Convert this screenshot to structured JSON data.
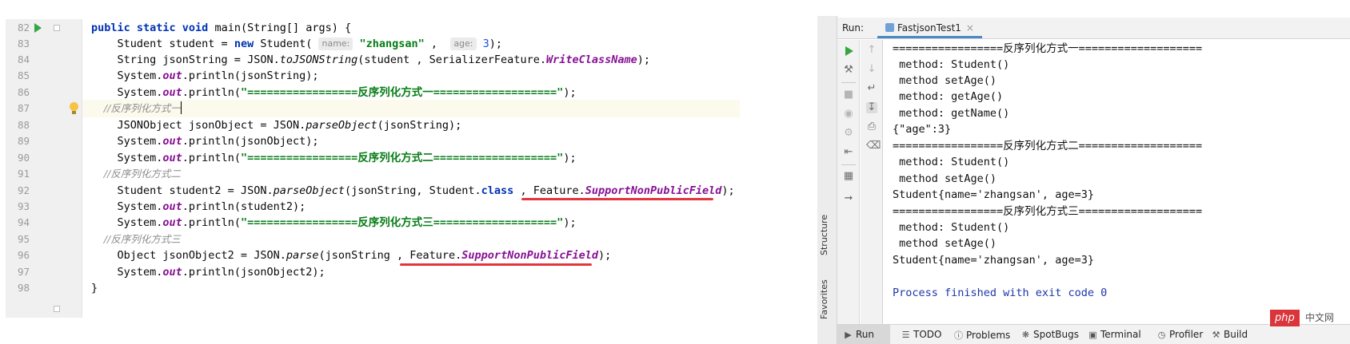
{
  "editor": {
    "line_numbers": [
      "82",
      "83",
      "84",
      "85",
      "86",
      "87",
      "88",
      "89",
      "90",
      "91",
      "92",
      "93",
      "94",
      "95",
      "96",
      "97",
      "98"
    ],
    "code": {
      "l82_a": "public static void ",
      "l82_b": "main(String[] args) {",
      "l83_a": "    Student student = ",
      "l83_new": "new ",
      "l83_b": "Student( ",
      "l83_hint1": "name:",
      "l83_str": " \"zhangsan\"",
      "l83_c": " ,  ",
      "l83_hint2": "age:",
      "l83_num": " 3",
      "l83_d": ");",
      "l84_a": "    String jsonString = JSON.",
      "l84_m": "toJSONString",
      "l84_b": "(student , SerializerFeature.",
      "l84_f": "WriteClassName",
      "l84_c": ");",
      "l85_a": "    System.",
      "l85_out": "out",
      "l85_b": ".println(jsonString);",
      "l86_a": "    System.",
      "l86_out": "out",
      "l86_b": ".println(",
      "l86_str": "\"=================反序列化方式一===================\"",
      "l86_c": ");",
      "l87_c": "    //反序列化方式一",
      "l88_a": "    JSONObject jsonObject = JSON.",
      "l88_m": "parseObject",
      "l88_b": "(jsonString);",
      "l89_a": "    System.",
      "l89_out": "out",
      "l89_b": ".println(jsonObject);",
      "l90_a": "    System.",
      "l90_out": "out",
      "l90_b": ".println(",
      "l90_str": "\"=================反序列化方式二===================\"",
      "l90_c": ");",
      "l91_c": "    //反序列化方式二",
      "l92_a": "    Student student2 = JSON.",
      "l92_m": "parseObject",
      "l92_b": "(jsonString, Student.",
      "l92_kw": "class",
      "l92_c": " , Feature.",
      "l92_f": "SupportNonPublicField",
      "l92_d": ");",
      "l93_a": "    System.",
      "l93_out": "out",
      "l93_b": ".println(student2);",
      "l94_a": "    System.",
      "l94_out": "out",
      "l94_b": ".println(",
      "l94_str": "\"=================反序列化方式三===================\"",
      "l94_c": ");",
      "l95_c": "    //反序列化方式三",
      "l96_a": "    Object jsonObject2 = JSON.",
      "l96_m": "parse",
      "l96_b": "(jsonString , Feature.",
      "l96_f": "SupportNonPublicField",
      "l96_c": ");",
      "l97_a": "    System.",
      "l97_out": "out",
      "l97_b": ".println(jsonObject2);",
      "l98_a": "}"
    }
  },
  "run_window": {
    "run_label": "Run:",
    "tab_label": "FastjsonTest1",
    "tab_close": "×",
    "side_tabs": {
      "structure": "Structure",
      "favorites": "Favorites"
    },
    "console_lines": [
      "=================反序列化方式一===================",
      " method: Student()",
      " method setAge()",
      " method: getAge()",
      " method: getName()",
      "{\"age\":3}",
      "=================反序列化方式二===================",
      " method: Student()",
      " method setAge()",
      "Student{name='zhangsan', age=3}",
      "=================反序列化方式三===================",
      " method: Student()",
      " method setAge()",
      "Student{name='zhangsan', age=3}",
      "",
      "Process finished with exit code 0"
    ]
  },
  "bottom_bar": {
    "run": "Run",
    "todo": "TODO",
    "problems": "Problems",
    "spotbugs": "SpotBugs",
    "terminal": "Terminal",
    "profiler": "Profiler",
    "build": "Build"
  },
  "watermark": {
    "logo": "php",
    "suffix": "中文网"
  },
  "colors": {
    "keyword": "#0033b3",
    "string": "#067d17",
    "field": "#871094",
    "comment": "#8c8c8c",
    "underline": "#e2363f",
    "console_exit": "#1f37a8"
  }
}
